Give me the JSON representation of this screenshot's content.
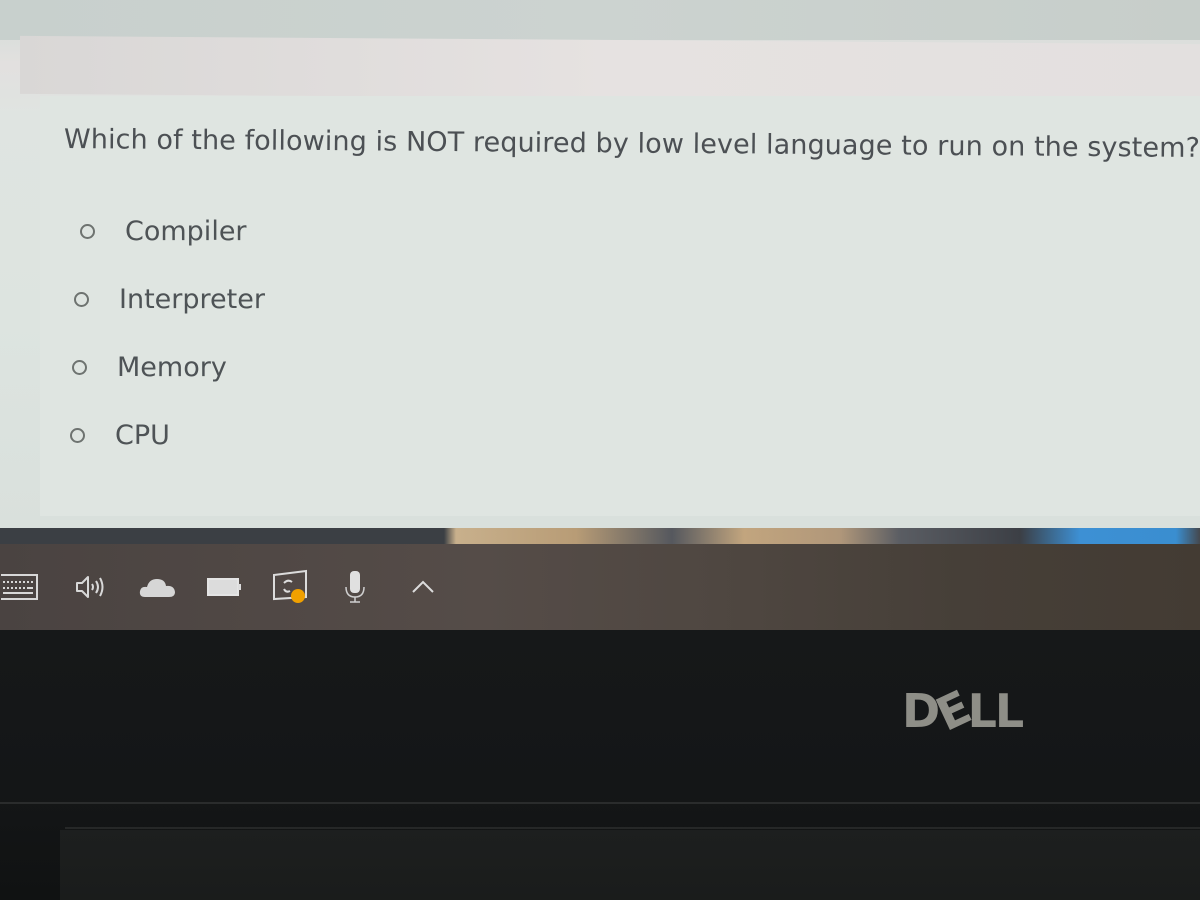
{
  "quiz": {
    "question": "Which of the following is NOT required by low level language to run on the system?",
    "options": [
      {
        "label": "Compiler",
        "selected": false
      },
      {
        "label": "Interpreter",
        "selected": false
      },
      {
        "label": "Memory",
        "selected": false
      },
      {
        "label": "CPU",
        "selected": false
      }
    ]
  },
  "taskbar": {
    "tray_icons": [
      {
        "name": "touch-keyboard-icon"
      },
      {
        "name": "volume-icon"
      },
      {
        "name": "onedrive-cloud-icon"
      },
      {
        "name": "battery-icon"
      },
      {
        "name": "sync-update-icon",
        "badge_color": "#f0a000"
      },
      {
        "name": "microphone-icon"
      },
      {
        "name": "show-hidden-icons-chevron"
      }
    ]
  },
  "device": {
    "brand_logo": {
      "left": "D",
      "e": "E",
      "right": "LL"
    }
  }
}
